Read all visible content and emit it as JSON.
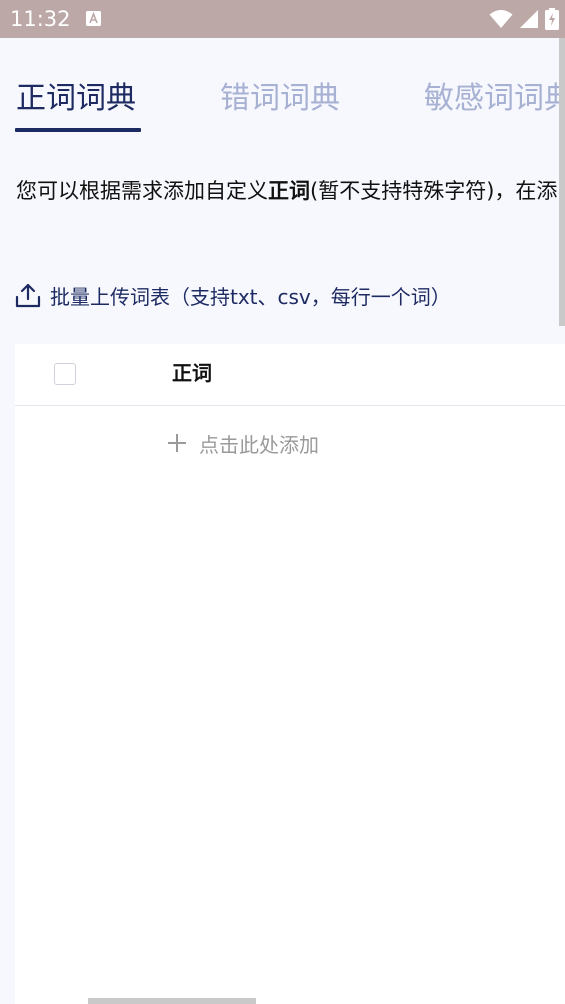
{
  "status_bar": {
    "time": "11:32",
    "notification_icon": "a-box-icon",
    "icons": [
      "wifi-icon",
      "signal-icon",
      "battery-charging-icon"
    ]
  },
  "tabs": [
    {
      "label": "正词词典",
      "active": true
    },
    {
      "label": "错词词典",
      "active": false
    },
    {
      "label": "敏感词词典",
      "active": false
    }
  ],
  "description": {
    "before": "您可以根据需求添加自定义",
    "bold": "正词",
    "after": "(暂不支持特殊字符)，在添"
  },
  "upload": {
    "icon": "upload-icon",
    "label": "批量上传词表（支持txt、csv，每行一个词）"
  },
  "table": {
    "column_header": "正词",
    "select_all_checked": false,
    "add_label": "点击此处添加",
    "add_icon": "plus-icon"
  },
  "colors": {
    "accent": "#1e2b63",
    "inactive_tab": "#a7b1d3",
    "status_bar": "#bca8a7",
    "page_bg": "#f7f8fd"
  }
}
